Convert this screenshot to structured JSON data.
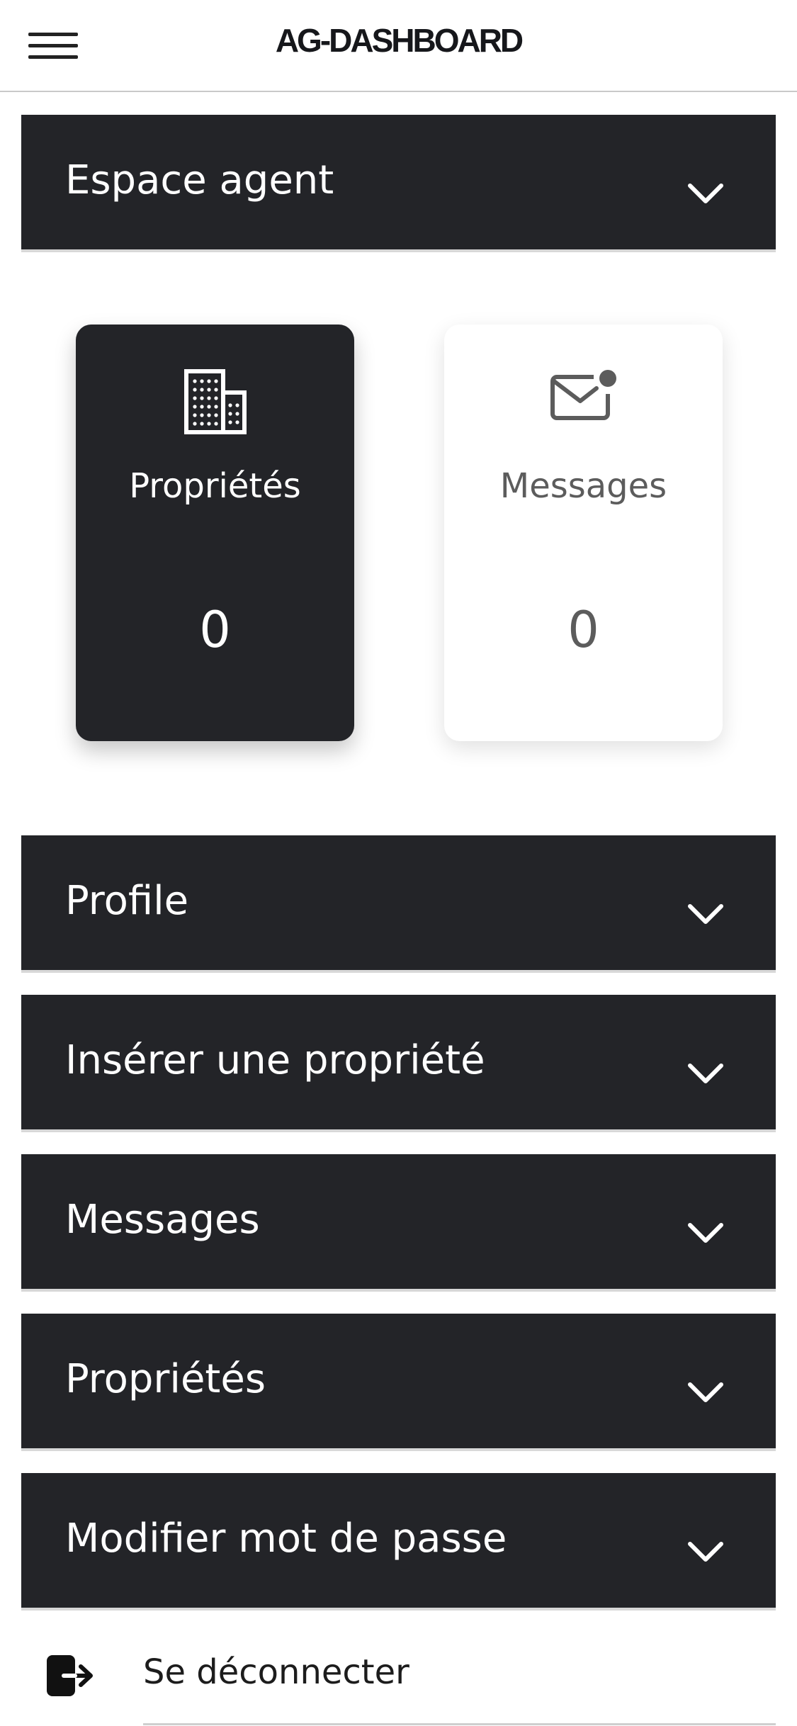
{
  "header": {
    "brand": "AG-DASHBOARD",
    "menu_icon": "hamburger-menu-icon"
  },
  "sections": {
    "agent": {
      "title": "Espace agent",
      "icon": "chevron-down-icon"
    },
    "profile": {
      "title": "Profile",
      "icon": "chevron-down-icon"
    },
    "insert_property": {
      "title": "Insérer une propriété",
      "icon": "chevron-down-icon"
    },
    "messages": {
      "title": "Messages",
      "icon": "chevron-down-icon"
    },
    "properties": {
      "title": "Propriétés",
      "icon": "chevron-down-icon"
    },
    "change_password": {
      "title": "Modifier mot de passe",
      "icon": "chevron-down-icon"
    }
  },
  "cards": {
    "properties": {
      "label": "Propriétés",
      "value": "0",
      "icon": "building-icon"
    },
    "messages": {
      "label": "Messages",
      "value": "0",
      "icon": "envelope-notification-icon"
    }
  },
  "logout": {
    "label": "Se déconnecter",
    "icon": "logout-icon"
  },
  "colors": {
    "dark": "#232428",
    "white": "#ffffff",
    "muted_text": "#5c5c5c"
  }
}
